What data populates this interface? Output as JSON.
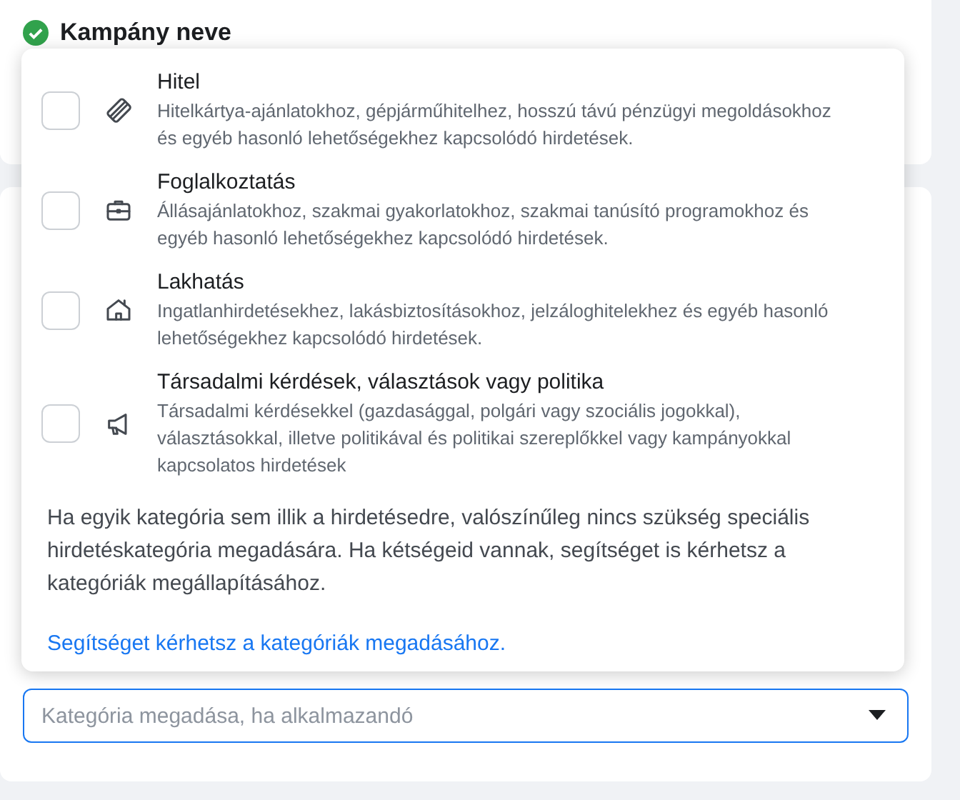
{
  "campaign_card": {
    "title": "Kampány neve",
    "complete": true
  },
  "category_card": {
    "select": {
      "placeholder": "Kategória megadása, ha alkalmazandó"
    }
  },
  "dropdown": {
    "options": [
      {
        "kind": "card",
        "title": "Hitel",
        "description": "Hitelkártya-ajánlatokhoz, gépjárműhitelhez, hosszú távú pénzügyi megoldásokhoz és egyéb hasonló lehetőségekhez kapcsolódó hirdetések.",
        "checked": false
      },
      {
        "kind": "briefcase",
        "title": "Foglalkoztatás",
        "description": "Állásajánlatokhoz, szakmai gyakorlatokhoz, szakmai tanúsító programokhoz és egyéb hasonló lehetőségekhez kapcsolódó hirdetések.",
        "checked": false
      },
      {
        "kind": "house",
        "title": "Lakhatás",
        "description": "Ingatlanhirdetésekhez, lakásbiztosításokhoz, jelzáloghitelekhez és egyéb hasonló lehetőségekhez kapcsolódó hirdetések.",
        "checked": false
      },
      {
        "kind": "megaphone",
        "title": "Társadalmi kérdések, választások vagy politika",
        "description": "Társadalmi kérdésekkel (gazdasággal, polgári vagy szociális jogokkal), választásokkal, illetve politikával és politikai szereplőkkel vagy kampányokkal kapcsolatos hirdetések",
        "checked": false
      }
    ],
    "note": "Ha egyik kategória sem illik a hirdetésedre, valószínűleg nincs szükség speciális hirdetéskategória megadására. Ha kétségeid vannak, segítséget is kérhetsz a kategóriák megállapításához.",
    "link": "Segítséget kérhetsz a kategóriák megadásához."
  }
}
